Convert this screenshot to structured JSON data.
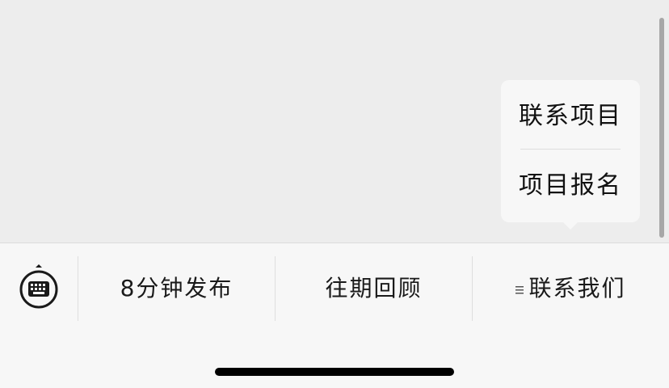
{
  "popup_menu": {
    "items": [
      {
        "label": "联系项目"
      },
      {
        "label": "项目报名"
      }
    ]
  },
  "bottom_menu": {
    "keyboard_icon": "keyboard-icon",
    "items": [
      {
        "label": "8分钟发布"
      },
      {
        "label": "往期回顾"
      },
      {
        "label": "联系我们",
        "icon": "submenu-icon"
      }
    ]
  }
}
